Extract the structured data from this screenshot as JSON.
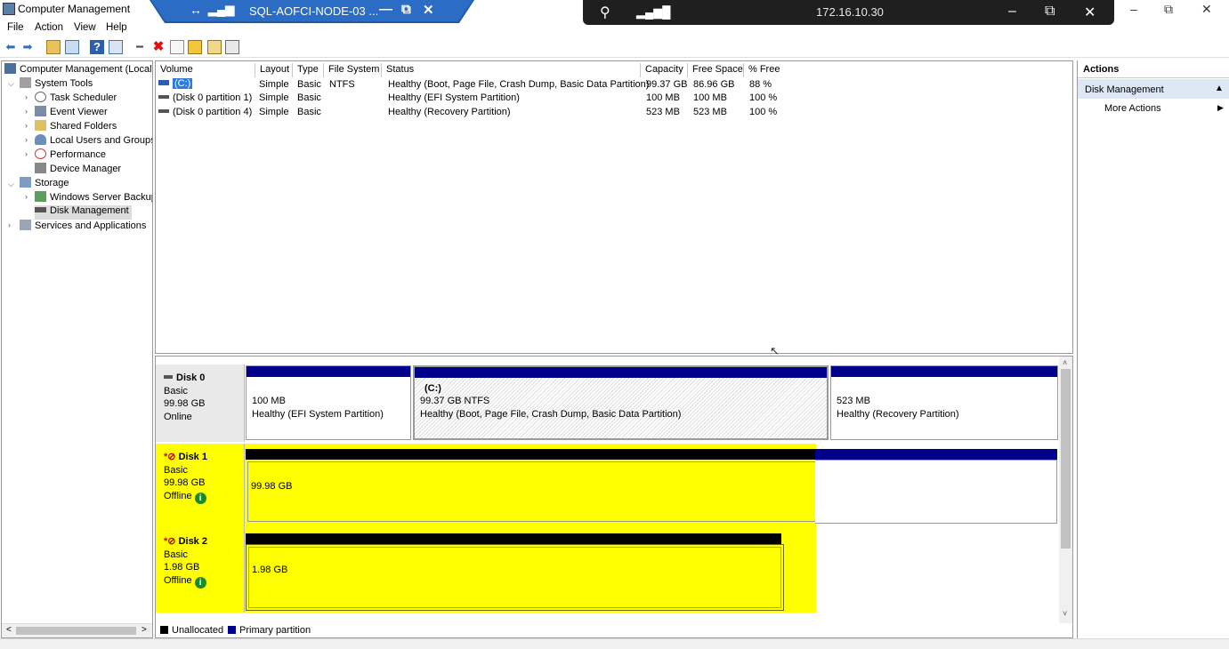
{
  "window": {
    "title": "Computer Management"
  },
  "rdp": {
    "host": "SQL-AOFCI-NODE-03 ...",
    "pin": "↔",
    "signal": "▂▄▆",
    "min": "—",
    "restore": "⧉",
    "close": "✕"
  },
  "connection": {
    "ip": "172.16.10.30",
    "pin": "⚲",
    "signal": "▂▄▆█",
    "min": "–",
    "restore": "⧉",
    "close": "✕"
  },
  "window_controls": {
    "min": "–",
    "restore": "⧉",
    "close": "✕"
  },
  "menu": [
    "File",
    "Action",
    "View",
    "Help"
  ],
  "tree": {
    "root": "Computer Management (Local)",
    "system_tools": "System Tools",
    "task_scheduler": "Task Scheduler",
    "event_viewer": "Event Viewer",
    "shared_folders": "Shared Folders",
    "local_users": "Local Users and Groups",
    "performance": "Performance",
    "device_manager": "Device Manager",
    "storage": "Storage",
    "wsb": "Windows Server Backup",
    "disk_mgmt": "Disk Management",
    "services": "Services and Applications"
  },
  "volumes": {
    "headers": [
      "Volume",
      "Layout",
      "Type",
      "File System",
      "Status",
      "Capacity",
      "Free Space",
      "% Free"
    ],
    "rows": [
      [
        "(C:)",
        "Simple",
        "Basic",
        "NTFS",
        "Healthy (Boot, Page File, Crash Dump, Basic Data Partition)",
        "99.37 GB",
        "86.96 GB",
        "88 %"
      ],
      [
        "(Disk 0 partition 1)",
        "Simple",
        "Basic",
        "",
        "Healthy (EFI System Partition)",
        "100 MB",
        "100 MB",
        "100 %"
      ],
      [
        "(Disk 0 partition 4)",
        "Simple",
        "Basic",
        "",
        "Healthy (Recovery Partition)",
        "523 MB",
        "523 MB",
        "100 %"
      ]
    ]
  },
  "disks": {
    "disk0": {
      "name": "Disk 0",
      "type": "Basic",
      "size": "99.98 GB",
      "state": "Online",
      "p1": {
        "size": "100 MB",
        "status": "Healthy (EFI System Partition)"
      },
      "p2": {
        "label": "(C:)",
        "size": "99.37 GB NTFS",
        "status": "Healthy (Boot, Page File, Crash Dump, Basic Data Partition)"
      },
      "p3": {
        "size": "523 MB",
        "status": "Healthy (Recovery Partition)"
      }
    },
    "disk1": {
      "name": "Disk 1",
      "type": "Basic",
      "size": "99.98 GB",
      "state": "Offline",
      "part": "99.98 GB"
    },
    "disk2": {
      "name": "Disk 2",
      "type": "Basic",
      "size": "1.98 GB",
      "state": "Offline",
      "part": "1.98 GB"
    }
  },
  "legend": {
    "unallocated": "Unallocated",
    "primary": "Primary partition"
  },
  "actions": {
    "header": "Actions",
    "section": "Disk Management",
    "more": "More Actions"
  },
  "colors": {
    "primary": "#00008b",
    "unallocated": "#000000",
    "highlight": "#ffff00",
    "rdp": "#1e5aa8",
    "conbar": "#1f1f1f"
  },
  "icons": {
    "info": "i",
    "offline": "*⊘"
  }
}
